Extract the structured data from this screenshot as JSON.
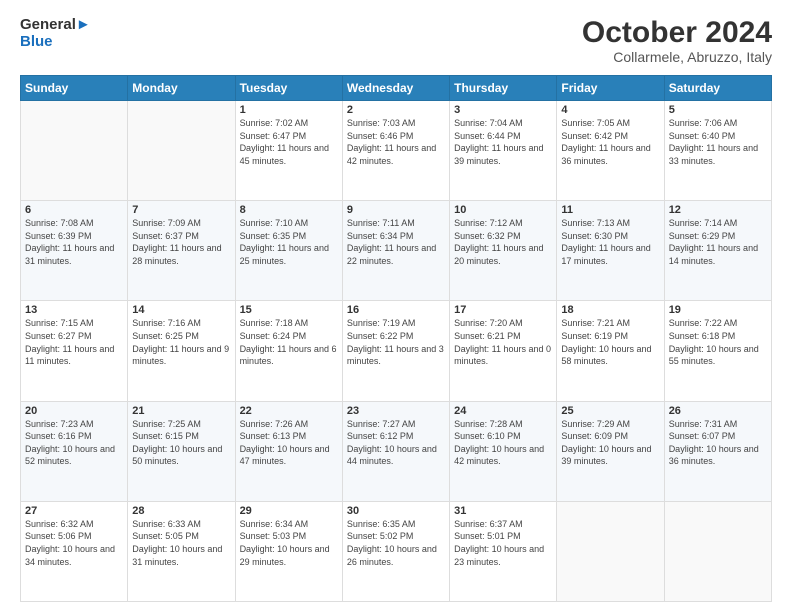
{
  "header": {
    "logo": {
      "line1": "General",
      "line2": "Blue"
    },
    "title": "October 2024",
    "location": "Collarmele, Abruzzo, Italy"
  },
  "weekdays": [
    "Sunday",
    "Monday",
    "Tuesday",
    "Wednesday",
    "Thursday",
    "Friday",
    "Saturday"
  ],
  "weeks": [
    [
      {
        "day": "",
        "sunrise": "",
        "sunset": "",
        "daylight": ""
      },
      {
        "day": "",
        "sunrise": "",
        "sunset": "",
        "daylight": ""
      },
      {
        "day": "1",
        "sunrise": "Sunrise: 7:02 AM",
        "sunset": "Sunset: 6:47 PM",
        "daylight": "Daylight: 11 hours and 45 minutes."
      },
      {
        "day": "2",
        "sunrise": "Sunrise: 7:03 AM",
        "sunset": "Sunset: 6:46 PM",
        "daylight": "Daylight: 11 hours and 42 minutes."
      },
      {
        "day": "3",
        "sunrise": "Sunrise: 7:04 AM",
        "sunset": "Sunset: 6:44 PM",
        "daylight": "Daylight: 11 hours and 39 minutes."
      },
      {
        "day": "4",
        "sunrise": "Sunrise: 7:05 AM",
        "sunset": "Sunset: 6:42 PM",
        "daylight": "Daylight: 11 hours and 36 minutes."
      },
      {
        "day": "5",
        "sunrise": "Sunrise: 7:06 AM",
        "sunset": "Sunset: 6:40 PM",
        "daylight": "Daylight: 11 hours and 33 minutes."
      }
    ],
    [
      {
        "day": "6",
        "sunrise": "Sunrise: 7:08 AM",
        "sunset": "Sunset: 6:39 PM",
        "daylight": "Daylight: 11 hours and 31 minutes."
      },
      {
        "day": "7",
        "sunrise": "Sunrise: 7:09 AM",
        "sunset": "Sunset: 6:37 PM",
        "daylight": "Daylight: 11 hours and 28 minutes."
      },
      {
        "day": "8",
        "sunrise": "Sunrise: 7:10 AM",
        "sunset": "Sunset: 6:35 PM",
        "daylight": "Daylight: 11 hours and 25 minutes."
      },
      {
        "day": "9",
        "sunrise": "Sunrise: 7:11 AM",
        "sunset": "Sunset: 6:34 PM",
        "daylight": "Daylight: 11 hours and 22 minutes."
      },
      {
        "day": "10",
        "sunrise": "Sunrise: 7:12 AM",
        "sunset": "Sunset: 6:32 PM",
        "daylight": "Daylight: 11 hours and 20 minutes."
      },
      {
        "day": "11",
        "sunrise": "Sunrise: 7:13 AM",
        "sunset": "Sunset: 6:30 PM",
        "daylight": "Daylight: 11 hours and 17 minutes."
      },
      {
        "day": "12",
        "sunrise": "Sunrise: 7:14 AM",
        "sunset": "Sunset: 6:29 PM",
        "daylight": "Daylight: 11 hours and 14 minutes."
      }
    ],
    [
      {
        "day": "13",
        "sunrise": "Sunrise: 7:15 AM",
        "sunset": "Sunset: 6:27 PM",
        "daylight": "Daylight: 11 hours and 11 minutes."
      },
      {
        "day": "14",
        "sunrise": "Sunrise: 7:16 AM",
        "sunset": "Sunset: 6:25 PM",
        "daylight": "Daylight: 11 hours and 9 minutes."
      },
      {
        "day": "15",
        "sunrise": "Sunrise: 7:18 AM",
        "sunset": "Sunset: 6:24 PM",
        "daylight": "Daylight: 11 hours and 6 minutes."
      },
      {
        "day": "16",
        "sunrise": "Sunrise: 7:19 AM",
        "sunset": "Sunset: 6:22 PM",
        "daylight": "Daylight: 11 hours and 3 minutes."
      },
      {
        "day": "17",
        "sunrise": "Sunrise: 7:20 AM",
        "sunset": "Sunset: 6:21 PM",
        "daylight": "Daylight: 11 hours and 0 minutes."
      },
      {
        "day": "18",
        "sunrise": "Sunrise: 7:21 AM",
        "sunset": "Sunset: 6:19 PM",
        "daylight": "Daylight: 10 hours and 58 minutes."
      },
      {
        "day": "19",
        "sunrise": "Sunrise: 7:22 AM",
        "sunset": "Sunset: 6:18 PM",
        "daylight": "Daylight: 10 hours and 55 minutes."
      }
    ],
    [
      {
        "day": "20",
        "sunrise": "Sunrise: 7:23 AM",
        "sunset": "Sunset: 6:16 PM",
        "daylight": "Daylight: 10 hours and 52 minutes."
      },
      {
        "day": "21",
        "sunrise": "Sunrise: 7:25 AM",
        "sunset": "Sunset: 6:15 PM",
        "daylight": "Daylight: 10 hours and 50 minutes."
      },
      {
        "day": "22",
        "sunrise": "Sunrise: 7:26 AM",
        "sunset": "Sunset: 6:13 PM",
        "daylight": "Daylight: 10 hours and 47 minutes."
      },
      {
        "day": "23",
        "sunrise": "Sunrise: 7:27 AM",
        "sunset": "Sunset: 6:12 PM",
        "daylight": "Daylight: 10 hours and 44 minutes."
      },
      {
        "day": "24",
        "sunrise": "Sunrise: 7:28 AM",
        "sunset": "Sunset: 6:10 PM",
        "daylight": "Daylight: 10 hours and 42 minutes."
      },
      {
        "day": "25",
        "sunrise": "Sunrise: 7:29 AM",
        "sunset": "Sunset: 6:09 PM",
        "daylight": "Daylight: 10 hours and 39 minutes."
      },
      {
        "day": "26",
        "sunrise": "Sunrise: 7:31 AM",
        "sunset": "Sunset: 6:07 PM",
        "daylight": "Daylight: 10 hours and 36 minutes."
      }
    ],
    [
      {
        "day": "27",
        "sunrise": "Sunrise: 6:32 AM",
        "sunset": "Sunset: 5:06 PM",
        "daylight": "Daylight: 10 hours and 34 minutes."
      },
      {
        "day": "28",
        "sunrise": "Sunrise: 6:33 AM",
        "sunset": "Sunset: 5:05 PM",
        "daylight": "Daylight: 10 hours and 31 minutes."
      },
      {
        "day": "29",
        "sunrise": "Sunrise: 6:34 AM",
        "sunset": "Sunset: 5:03 PM",
        "daylight": "Daylight: 10 hours and 29 minutes."
      },
      {
        "day": "30",
        "sunrise": "Sunrise: 6:35 AM",
        "sunset": "Sunset: 5:02 PM",
        "daylight": "Daylight: 10 hours and 26 minutes."
      },
      {
        "day": "31",
        "sunrise": "Sunrise: 6:37 AM",
        "sunset": "Sunset: 5:01 PM",
        "daylight": "Daylight: 10 hours and 23 minutes."
      },
      {
        "day": "",
        "sunrise": "",
        "sunset": "",
        "daylight": ""
      },
      {
        "day": "",
        "sunrise": "",
        "sunset": "",
        "daylight": ""
      }
    ]
  ]
}
